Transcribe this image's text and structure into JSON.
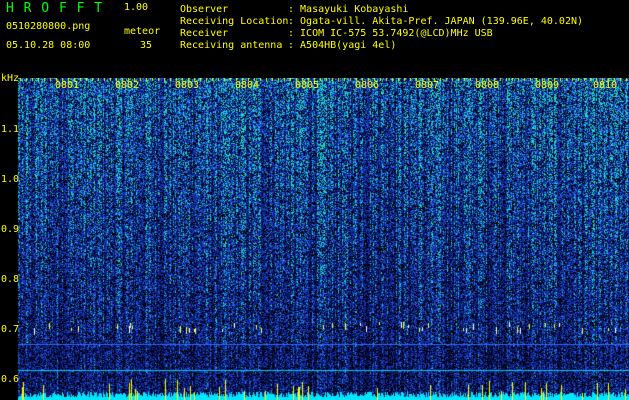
{
  "header": {
    "app_title": "H R O F F T",
    "version": "1.00",
    "filename": "0510280800.png",
    "meteor_label": "meteor",
    "meteor_count": "35",
    "datetime": "05.10.28 08:00",
    "fields": [
      {
        "label": "Observer",
        "value": ": Masayuki Kobayashi"
      },
      {
        "label": "Receiving Location",
        "value": ": Ogata-vill. Akita-Pref. JAPAN (139.96E, 40.02N)"
      },
      {
        "label": "Receiver",
        "value": ": ICOM IC-575 53.7492(@LCD)MHz USB"
      },
      {
        "label": "Receiving antenna",
        "value": ": A504HB(yagi 4el)"
      }
    ]
  },
  "spectrogram": {
    "y_unit": "kHz",
    "y_ticks": [
      "1.1",
      "1.0",
      "0.9",
      "0.8",
      "0.7",
      "0.6"
    ],
    "x_ticks": [
      "0801",
      "0802",
      "0803",
      "0804",
      "0805",
      "0806",
      "0807",
      "0808",
      "0809",
      "0810"
    ],
    "colors": {
      "background": "#000000",
      "label": "#ffff00",
      "title": "#00ff00",
      "noise_low": "#0a1e6e",
      "noise_mid": "#1e46dc",
      "noise_high": "#14c8c8",
      "meteor": "#ffff00",
      "baseline": "#00e6ff"
    }
  }
}
